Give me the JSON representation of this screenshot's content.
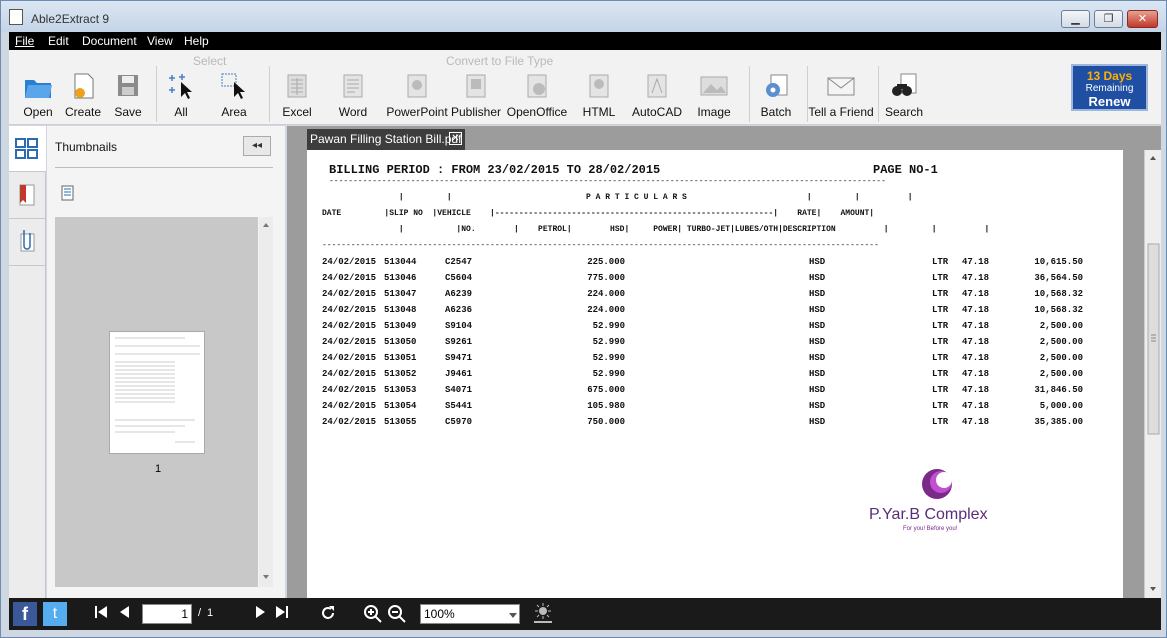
{
  "window": {
    "title": "Able2Extract 9",
    "minimize": "▁",
    "maximize": "❐",
    "close": "✕"
  },
  "menu": [
    "File",
    "Edit",
    "Document",
    "View",
    "Help"
  ],
  "toolbar": {
    "select_group": "Select",
    "convert_group": "Convert to File Type",
    "open": "Open",
    "create": "Create",
    "save": "Save",
    "all": "All",
    "area": "Area",
    "excel": "Excel",
    "word": "Word",
    "powerpoint": "PowerPoint",
    "publisher": "Publisher",
    "openoffice": "OpenOffice",
    "html": "HTML",
    "autocad": "AutoCAD",
    "image": "Image",
    "batch": "Batch",
    "tell_friend": "Tell a Friend",
    "search": "Search"
  },
  "trial": {
    "days": "13 Days",
    "remaining": "Remaining",
    "renew": "Renew"
  },
  "sidebar": {
    "thumbnails_label": "Thumbnails",
    "collapse": "◂◂",
    "thumb_page_number": "1"
  },
  "document": {
    "tab_title": "Pawan Filling Station Bill.pdf",
    "header_line": "BILLING PERIOD : FROM 23/02/2015 TO 28/02/2015",
    "page_no": "PAGE NO-1",
    "rule": "--------------------------------------------------------------------------------------------------------------------",
    "col_line1": "                |         |                            P A R T I C U L A R S                         |         |          |",
    "col_line2": "DATE         |SLIP NO  |VEHICLE    |----------------------------------------------------------|    RATE|    AMOUNT|",
    "col_line3": "                |           |NO.        |    PETROL|        HSD|     POWER| TURBO-JET|LUBES/OTH|DESCRIPTION          |         |          |",
    "rows": [
      [
        "24/02/2015",
        "513044",
        "C2547",
        "225.000",
        "HSD",
        "LTR",
        "47.18",
        "10,615.50"
      ],
      [
        "24/02/2015",
        "513046",
        "C5604",
        "775.000",
        "HSD",
        "LTR",
        "47.18",
        "36,564.50"
      ],
      [
        "24/02/2015",
        "513047",
        "A6239",
        "224.000",
        "HSD",
        "LTR",
        "47.18",
        "10,568.32"
      ],
      [
        "24/02/2015",
        "513048",
        "A6236",
        "224.000",
        "HSD",
        "LTR",
        "47.18",
        "10,568.32"
      ],
      [
        "24/02/2015",
        "513049",
        "S9104",
        "52.990",
        "HSD",
        "LTR",
        "47.18",
        "2,500.00"
      ],
      [
        "24/02/2015",
        "513050",
        "S9261",
        "52.990",
        "HSD",
        "LTR",
        "47.18",
        "2,500.00"
      ],
      [
        "24/02/2015",
        "513051",
        "S9471",
        "52.990",
        "HSD",
        "LTR",
        "47.18",
        "2,500.00"
      ],
      [
        "24/02/2015",
        "513052",
        "J9461",
        "52.990",
        "HSD",
        "LTR",
        "47.18",
        "2,500.00"
      ],
      [
        "24/02/2015",
        "513053",
        "S4071",
        "675.000",
        "HSD",
        "LTR",
        "47.18",
        "31,846.50"
      ],
      [
        "24/02/2015",
        "513054",
        "S5441",
        "105.980",
        "HSD",
        "LTR",
        "47.18",
        "5,000.00"
      ],
      [
        "24/02/2015",
        "513055",
        "C5970",
        "750.000",
        "HSD",
        "LTR",
        "47.18",
        "35,385.00"
      ]
    ],
    "logo_text": "P.Yar.B Complex",
    "logo_tagline": "For you! Before you!"
  },
  "statusbar": {
    "facebook": "f",
    "twitter": "t",
    "current_page": "1",
    "page_sep": "/",
    "total_pages": "1",
    "zoom": "100%"
  },
  "colors": {
    "menubar": "#000000",
    "tab": "#3d3d3d",
    "renew_bg": "#1f4fa3",
    "days": "#ffb000",
    "logo": "#7b2a8a"
  }
}
